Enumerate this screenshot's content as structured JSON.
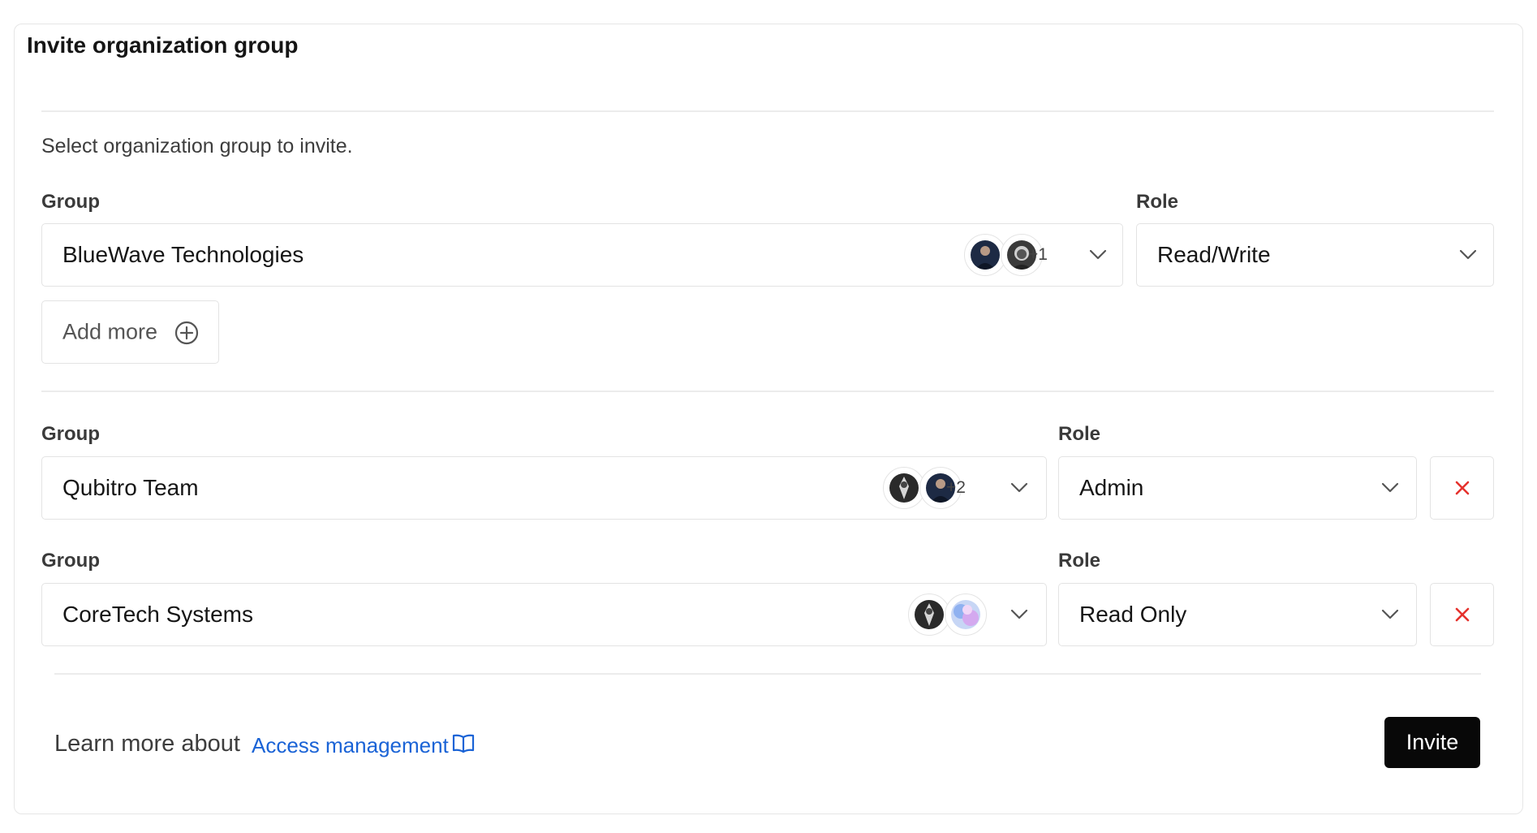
{
  "dialog": {
    "title": "Invite organization group",
    "subtitle": "Select organization group to invite."
  },
  "rows": [
    {
      "group_label": "Group",
      "group_value": "BlueWave Technologies",
      "members_extra": "+1",
      "role_label": "Role",
      "role_value": "Read/Write"
    },
    {
      "group_label": "Group",
      "group_value": "Qubitro Team",
      "members_extra": "+2",
      "role_label": "Role",
      "role_value": "Admin"
    },
    {
      "group_label": "Group",
      "group_value": "CoreTech Systems",
      "role_label": "Role",
      "role_value": "Read Only"
    }
  ],
  "add_more_label": "Add more",
  "footer": {
    "learn_more_text": "Learn more about",
    "link_text": "Access management",
    "invite_label": "Invite"
  },
  "colors": {
    "link": "#1a63d6",
    "remove": "#e5322d",
    "primary_button": "#080808"
  }
}
